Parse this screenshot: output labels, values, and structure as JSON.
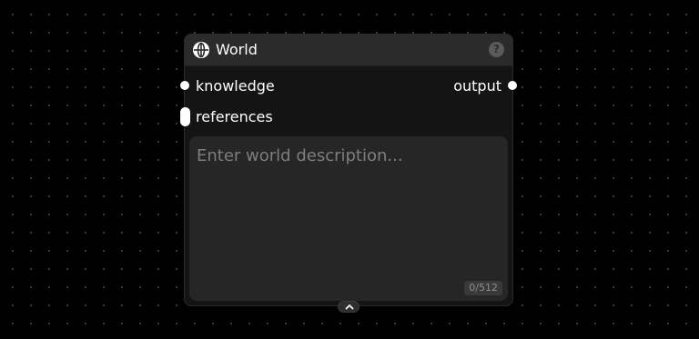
{
  "node": {
    "title": "World",
    "help_icon": "?",
    "icons": {
      "node_icon": "globe-icon",
      "help": "help-icon",
      "collapse": "chevron-up-icon"
    },
    "inputs": [
      {
        "label": "knowledge"
      },
      {
        "label": "references"
      }
    ],
    "outputs": [
      {
        "label": "output"
      }
    ],
    "description": {
      "value": "",
      "placeholder": "Enter world description...",
      "char_count": "0/512"
    }
  },
  "colors": {
    "canvas_bg": "#000000",
    "node_bg": "#141414",
    "header_bg": "#2b2b2b",
    "textarea_bg": "#262626",
    "port": "#ffffff"
  }
}
